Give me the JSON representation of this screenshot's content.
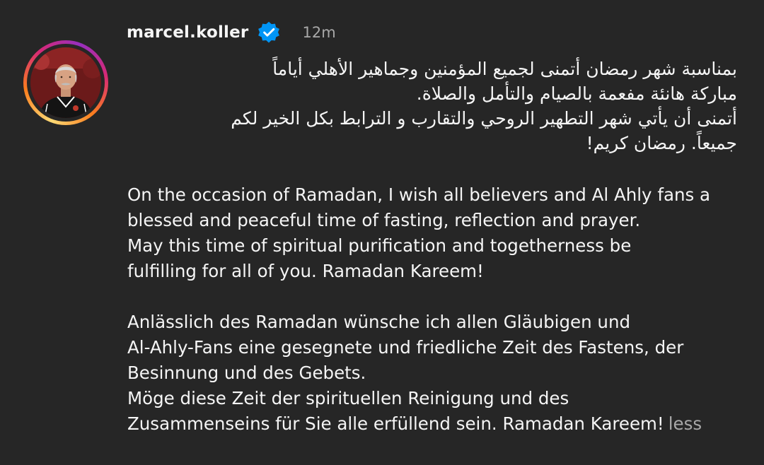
{
  "post": {
    "username": "marcel.koller",
    "verified_icon": "verified-badge-icon",
    "timestamp": "12m",
    "arabic_lines": [
      "بمناسبة شهر رمضان أتمنى لجميع المؤمنين وجماهير الأهلي أياماً",
      "مباركة هانئة مفعمة بالصيام والتأمل والصلاة.",
      " أتمنى أن يأتي شهر التطهير الروحي والتقارب و الترابط بكل الخير لكم",
      "جميعاً. رمضان كريم!"
    ],
    "english_lines": [
      "On the occasion of Ramadan, I wish all believers and Al Ahly fans a",
      "blessed and peaceful time of fasting, reflection and prayer.",
      "May this time of spiritual purification and togetherness be",
      "fulfilling for all of you. Ramadan Kareem!"
    ],
    "german_lines": [
      "Anlässlich des Ramadan wünsche ich allen Gläubigen und",
      "Al-Ahly-Fans eine gesegnete und friedliche Zeit des Fastens, der",
      "Besinnung und des Gebets.",
      "Möge diese Zeit der spirituellen Reinigung und des",
      "Zusammenseins für Sie alle erfüllend sein. Ramadan Kareem!"
    ],
    "less_label": "less"
  },
  "colors": {
    "background": "#262626",
    "text": "#f5f5f5",
    "muted": "#a8a8a8",
    "verified": "#0095f6"
  }
}
